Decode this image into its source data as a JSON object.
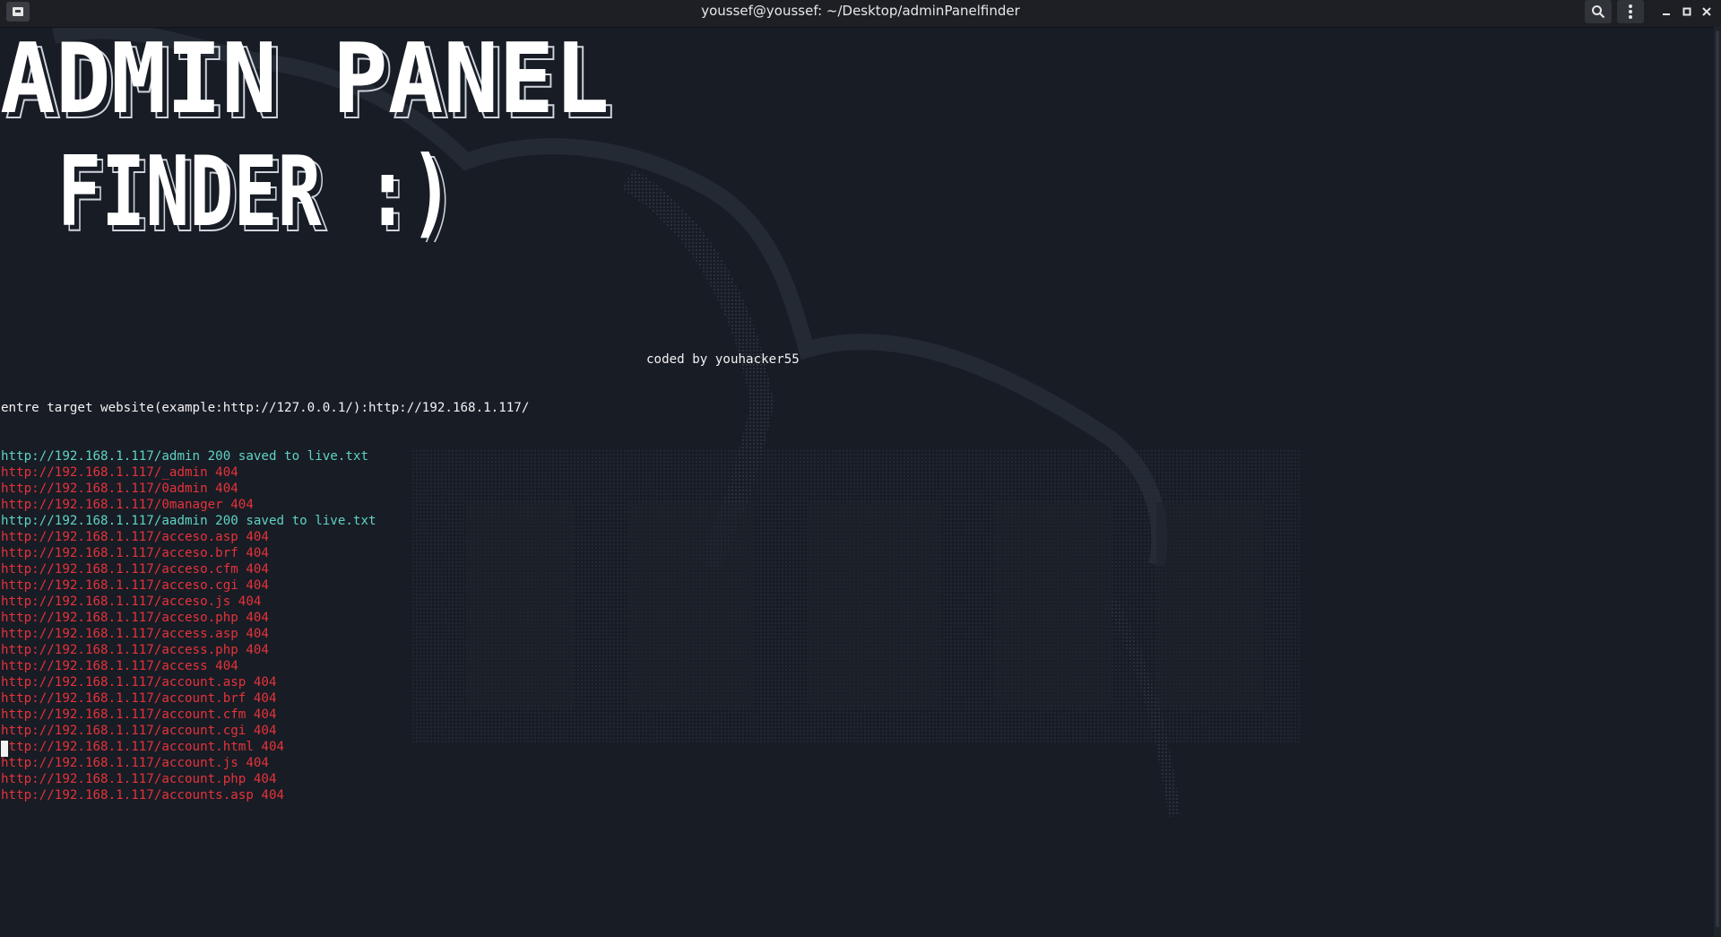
{
  "window": {
    "title": "youssef@youssef: ~/Desktop/adminPanelfinder"
  },
  "icons": {
    "app": "terminal-app-icon",
    "search": "search-icon",
    "menu": "kebab-menu-icon",
    "minimize": "minimize-icon",
    "maximize": "maximize-icon",
    "close": "close-icon"
  },
  "banner": {
    "line1": "ADMIN PANEL",
    "line2": "FINDER :)"
  },
  "credit": "coded by youhacker55",
  "prompt": "entre target website(example:http://127.0.0.1/):http://192.168.1.117/",
  "results": [
    {
      "text": "http://192.168.1.117/admin 200 saved to live.txt",
      "status": "ok"
    },
    {
      "text": "http://192.168.1.117/_admin 404",
      "status": "err"
    },
    {
      "text": "http://192.168.1.117/0admin 404",
      "status": "err"
    },
    {
      "text": "http://192.168.1.117/0manager 404",
      "status": "err"
    },
    {
      "text": "http://192.168.1.117/aadmin 200 saved to live.txt",
      "status": "ok"
    },
    {
      "text": "http://192.168.1.117/acceso.asp 404",
      "status": "err"
    },
    {
      "text": "http://192.168.1.117/acceso.brf 404",
      "status": "err"
    },
    {
      "text": "http://192.168.1.117/acceso.cfm 404",
      "status": "err"
    },
    {
      "text": "http://192.168.1.117/acceso.cgi 404",
      "status": "err"
    },
    {
      "text": "http://192.168.1.117/acceso.js 404",
      "status": "err"
    },
    {
      "text": "http://192.168.1.117/acceso.php 404",
      "status": "err"
    },
    {
      "text": "http://192.168.1.117/access.asp 404",
      "status": "err"
    },
    {
      "text": "http://192.168.1.117/access.php 404",
      "status": "err"
    },
    {
      "text": "http://192.168.1.117/access 404",
      "status": "err"
    },
    {
      "text": "http://192.168.1.117/account.asp 404",
      "status": "err"
    },
    {
      "text": "http://192.168.1.117/account.brf 404",
      "status": "err"
    },
    {
      "text": "http://192.168.1.117/account.cfm 404",
      "status": "err"
    },
    {
      "text": "http://192.168.1.117/account.cgi 404",
      "status": "err"
    },
    {
      "text": "http://192.168.1.117/account.html 404",
      "status": "err"
    },
    {
      "text": "http://192.168.1.117/account.js 404",
      "status": "err"
    },
    {
      "text": "http://192.168.1.117/account.php 404",
      "status": "err"
    },
    {
      "text": "http://192.168.1.117/accounts.asp 404",
      "status": "err"
    }
  ],
  "colors": {
    "background": "#181c25",
    "ok": "#5fd3c4",
    "err": "#e5333a",
    "text": "#f2f2f2"
  }
}
